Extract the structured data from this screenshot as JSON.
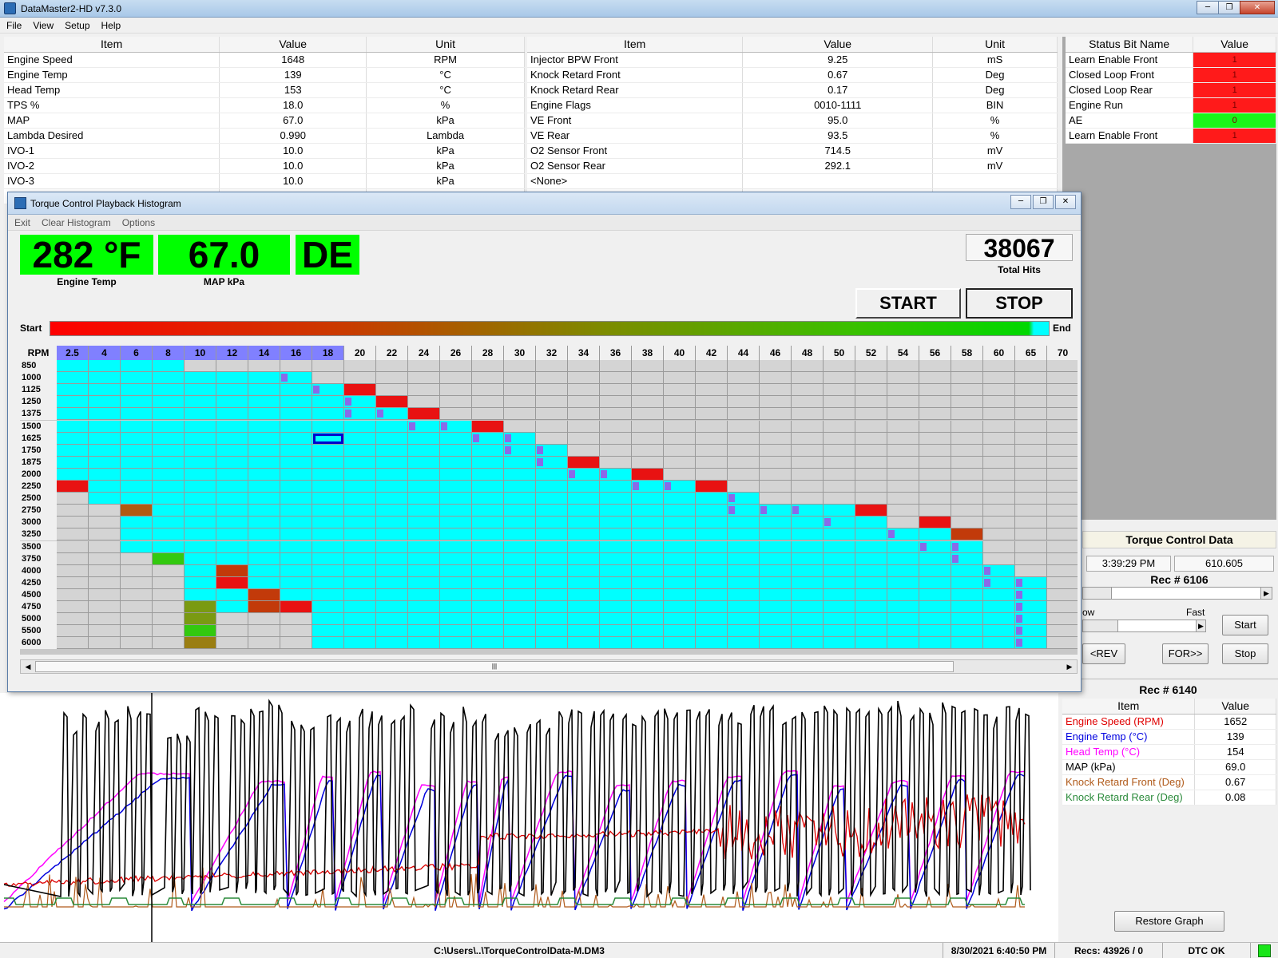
{
  "app": {
    "title": "DataMaster2-HD  v7.3.0"
  },
  "menu": [
    "File",
    "View",
    "Setup",
    "Help"
  ],
  "headers": {
    "item": "Item",
    "value": "Value",
    "unit": "Unit"
  },
  "left_table": [
    {
      "item": "Engine Speed",
      "value": "1648",
      "unit": "RPM"
    },
    {
      "item": "Engine Temp",
      "value": "139",
      "unit": "°C"
    },
    {
      "item": "Head Temp",
      "value": "153",
      "unit": "°C"
    },
    {
      "item": "TPS %",
      "value": "18.0",
      "unit": "%"
    },
    {
      "item": "MAP",
      "value": "67.0",
      "unit": "kPa"
    },
    {
      "item": "Lambda Desired",
      "value": "0.990",
      "unit": "Lambda"
    },
    {
      "item": "IVO-1",
      "value": "10.0",
      "unit": "kPa"
    },
    {
      "item": "IVO-2",
      "value": "10.0",
      "unit": "kPa"
    },
    {
      "item": "IVO-3",
      "value": "10.0",
      "unit": "kPa"
    }
  ],
  "mid_table": [
    {
      "item": "Injector BPW Front",
      "value": "9.25",
      "unit": "mS"
    },
    {
      "item": "Knock Retard Front",
      "value": "0.67",
      "unit": "Deg"
    },
    {
      "item": "Knock Retard Rear",
      "value": "0.17",
      "unit": "Deg"
    },
    {
      "item": "Engine Flags",
      "value": "0010-1111",
      "unit": "BIN"
    },
    {
      "item": "VE Front",
      "value": "95.0",
      "unit": "%"
    },
    {
      "item": "VE Rear",
      "value": "93.5",
      "unit": "%"
    },
    {
      "item": "O2 Sensor Front",
      "value": "714.5",
      "unit": "mV"
    },
    {
      "item": "O2 Sensor Rear",
      "value": "292.1",
      "unit": "mV"
    },
    {
      "item": "<None>",
      "value": "",
      "unit": ""
    }
  ],
  "status_bits": {
    "header_name": "Status Bit Name",
    "header_value": "Value",
    "rows": [
      {
        "name": "Learn Enable Front",
        "value": "1",
        "color": "#ff1a1a"
      },
      {
        "name": "Closed Loop Front",
        "value": "1",
        "color": "#ff1a1a"
      },
      {
        "name": "Closed Loop Rear",
        "value": "1",
        "color": "#ff1a1a"
      },
      {
        "name": "Engine Run",
        "value": "1",
        "color": "#ff1a1a"
      },
      {
        "name": "AE",
        "value": "0",
        "color": "#19f519"
      },
      {
        "name": "Learn Enable Front",
        "value": "1",
        "color": "#ff1a1a"
      }
    ]
  },
  "playback": {
    "title": "Torque Control Data",
    "time": "3:39:29 PM",
    "value": "610.605",
    "rec": "Rec # 6106",
    "slow_label": "ow",
    "fast_label": "Fast",
    "start": "Start",
    "rev": "<REV",
    "for": "FOR>>",
    "stop": "Stop"
  },
  "legend": {
    "rec": "Rec # 6140",
    "header_item": "Item",
    "header_value": "Value",
    "rows": [
      {
        "item": "Engine Speed (RPM)",
        "value": "1652",
        "color": "#e00000"
      },
      {
        "item": "Engine Temp (°C)",
        "value": "139",
        "color": "#0000e0"
      },
      {
        "item": "Head Temp (°C)",
        "value": "154",
        "color": "#ff00ff"
      },
      {
        "item": "MAP (kPa)",
        "value": "69.0",
        "color": "#000000"
      },
      {
        "item": "Knock Retard Front (Deg)",
        "value": "0.67",
        "color": "#b05a1a"
      },
      {
        "item": "Knock Retard Rear (Deg)",
        "value": "0.08",
        "color": "#2a8a3a"
      }
    ],
    "restore": "Restore Graph"
  },
  "histogram": {
    "title": "Torque Control Playback Histogram",
    "menu": [
      "Exit",
      "Clear Histogram",
      "Options"
    ],
    "engine_temp": "282 °F",
    "engine_temp_label": "Engine Temp",
    "map": "67.0",
    "map_label": "MAP kPa",
    "mode": "DE",
    "hits": "38067",
    "hits_label": "Total Hits",
    "start_btn": "START",
    "stop_btn": "STOP",
    "bar_start": "Start",
    "bar_end": "End",
    "row_header": "RPM",
    "columns": [
      "2.5",
      "4",
      "6",
      "8",
      "10",
      "12",
      "14",
      "16",
      "18",
      "20",
      "22",
      "24",
      "26",
      "28",
      "30",
      "32",
      "34",
      "36",
      "38",
      "40",
      "42",
      "44",
      "46",
      "48",
      "50",
      "52",
      "54",
      "56",
      "58",
      "60",
      "65",
      "70"
    ],
    "rows": [
      "850",
      "1000",
      "1125",
      "1250",
      "1375",
      "1500",
      "1625",
      "1750",
      "1875",
      "2000",
      "2250",
      "2500",
      "2750",
      "3000",
      "3250",
      "3500",
      "3750",
      "4000",
      "4250",
      "4500",
      "4750",
      "5000",
      "5500",
      "6000"
    ],
    "header_highlight": "#8080ff",
    "colors": {
      "fill": "#00ffff",
      "empty": "#d4d4d4",
      "red": "#e81212",
      "orange": "#c23a0a",
      "brown": "#b05a12",
      "green": "#33c90f",
      "olive": "#7a9a12",
      "dark_olive": "#9a7e12",
      "marker": "#8a6ae8"
    }
  },
  "status": {
    "file": "C:\\Users\\..\\TorqueControlData-M.DM3",
    "datetime": "8/30/2021   6:40:50 PM",
    "recs": "Recs: 43926 / 0",
    "dtc": "DTC OK"
  }
}
